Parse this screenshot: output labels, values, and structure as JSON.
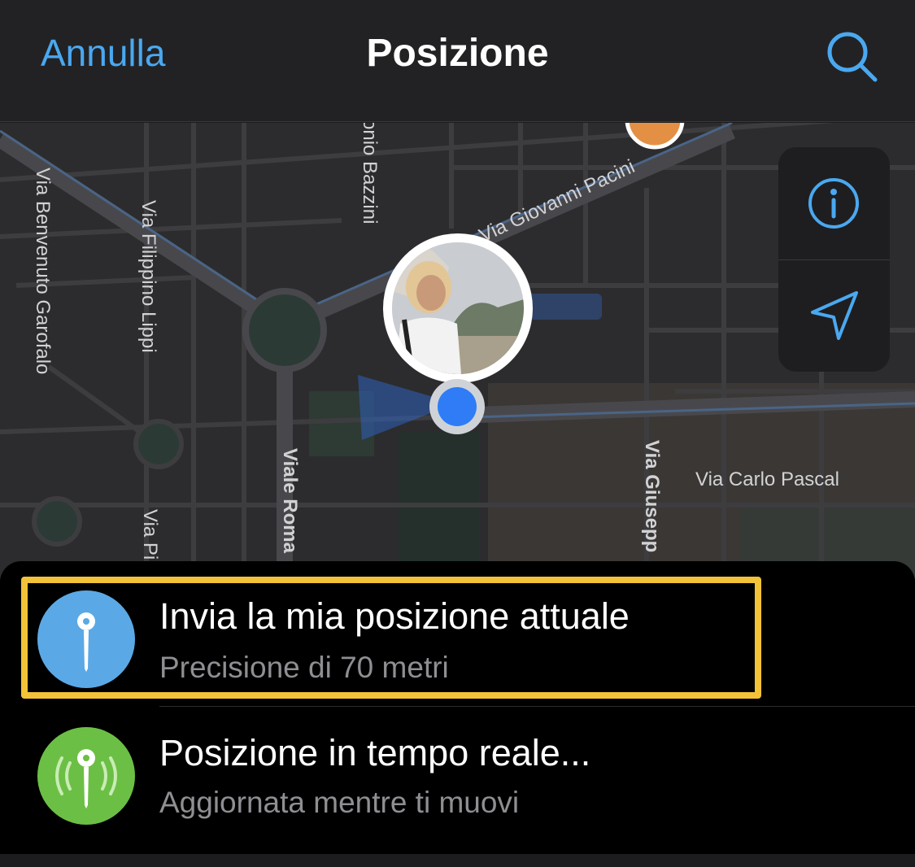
{
  "navbar": {
    "cancel_label": "Annulla",
    "title": "Posizione",
    "search_icon": "search-icon"
  },
  "map": {
    "streets": {
      "benvenuto": "Via Benvenuto Garofalo",
      "filippino": "Via Filippino Lippi",
      "bazzini": "onio Bazzini",
      "pacini": "Via Giovanni Pacini",
      "romagna": "Viale Roma",
      "giuseppe": "Via Giusepp",
      "pascal": "Via Carlo Pascal",
      "pi": "Via Pi"
    },
    "controls": {
      "info_icon": "info-icon",
      "locate_icon": "location-arrow-icon"
    },
    "colors": {
      "accent": "#4aa8f0",
      "user_dot": "#2f7cf6"
    }
  },
  "sheet": {
    "items": [
      {
        "title": "Invia la mia posizione attuale",
        "subtitle": "Precisione di 70 metri",
        "icon": "pin-icon",
        "color": "#5aa9e6",
        "highlighted": true
      },
      {
        "title": "Posizione in tempo reale...",
        "subtitle": "Aggiornata mentre ti muovi",
        "icon": "live-location-icon",
        "color": "#6cbf45"
      }
    ]
  }
}
